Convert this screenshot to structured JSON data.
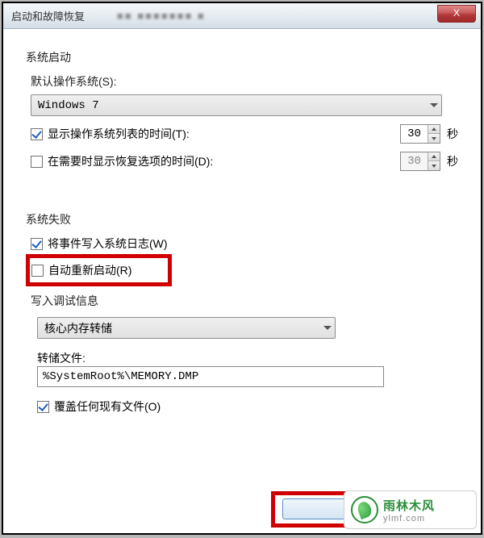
{
  "window": {
    "title": "启动和故障恢复",
    "close_glyph": "X"
  },
  "startup": {
    "section": "系统启动",
    "default_os_label": "默认操作系统(S):",
    "default_os_value": "Windows 7",
    "show_os_list": {
      "checked": true,
      "label": "显示操作系统列表的时间(T):",
      "value": "30",
      "unit": "秒"
    },
    "show_recovery": {
      "checked": false,
      "label": "在需要时显示恢复选项的时间(D):",
      "value": "30",
      "unit": "秒"
    }
  },
  "failure": {
    "section": "系统失败",
    "write_event": {
      "checked": true,
      "label": "将事件写入系统日志(W)"
    },
    "auto_restart": {
      "checked": false,
      "label": "自动重新启动(R)"
    },
    "debug_section": "写入调试信息",
    "debug_type": "核心内存转储",
    "dump_label": "转储文件:",
    "dump_path": "%SystemRoot%\\MEMORY.DMP",
    "overwrite": {
      "checked": true,
      "label": "覆盖任何现有文件(O)"
    }
  },
  "watermark": {
    "title": "雨林木风",
    "url": "ylmf.com"
  }
}
